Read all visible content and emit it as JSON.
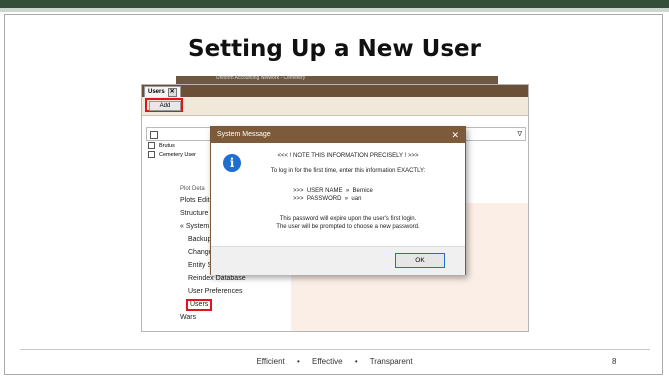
{
  "slide": {
    "title": "Setting Up a New User",
    "footer": [
      "Efficient",
      "Effective",
      "Transparent"
    ],
    "footer_separator": "•",
    "page_number": "8",
    "colors": {
      "top_bar": "#344e3a",
      "highlight": "#e0141a",
      "dialog_titlebar": "#7d5b3a",
      "info_icon": "#1f6fce"
    }
  },
  "app": {
    "window_title": "Uniform Accounting Network - Cemetery",
    "tab_label": "Users",
    "tab_close": "✕",
    "add_button": "Add",
    "filter_icon": "∇",
    "grid_rows": [
      "Brutus",
      "Cemetery User"
    ],
    "nav_items": [
      {
        "label": "Plots Edit"
      },
      {
        "label": "Structure"
      },
      {
        "label": "« System"
      },
      {
        "label": "Backup"
      },
      {
        "label": "Change"
      },
      {
        "label": "Entity S"
      },
      {
        "label": "Reindex Database"
      },
      {
        "label": "User Preferences"
      },
      {
        "label": "Users"
      },
      {
        "label": "Wars"
      }
    ],
    "nav_partial_top": "Plot Deta"
  },
  "dialog": {
    "title": "System Message",
    "close": "✕",
    "icon": "info-icon",
    "icon_glyph": "i",
    "heading": "<<<  !  NOTE THIS INFORMATION PRECISELY  !  >>>",
    "intro": "To log in for the first time, enter this information EXACTLY:",
    "username_line": ">>>  USER NAME  »  Bernice",
    "password_line": ">>>  PASSWORD  »  uan",
    "expire_line": "This password will expire upon the user's first login.",
    "prompt_line": "The user will be prompted to choose a new password.",
    "ok_button": "OK"
  }
}
